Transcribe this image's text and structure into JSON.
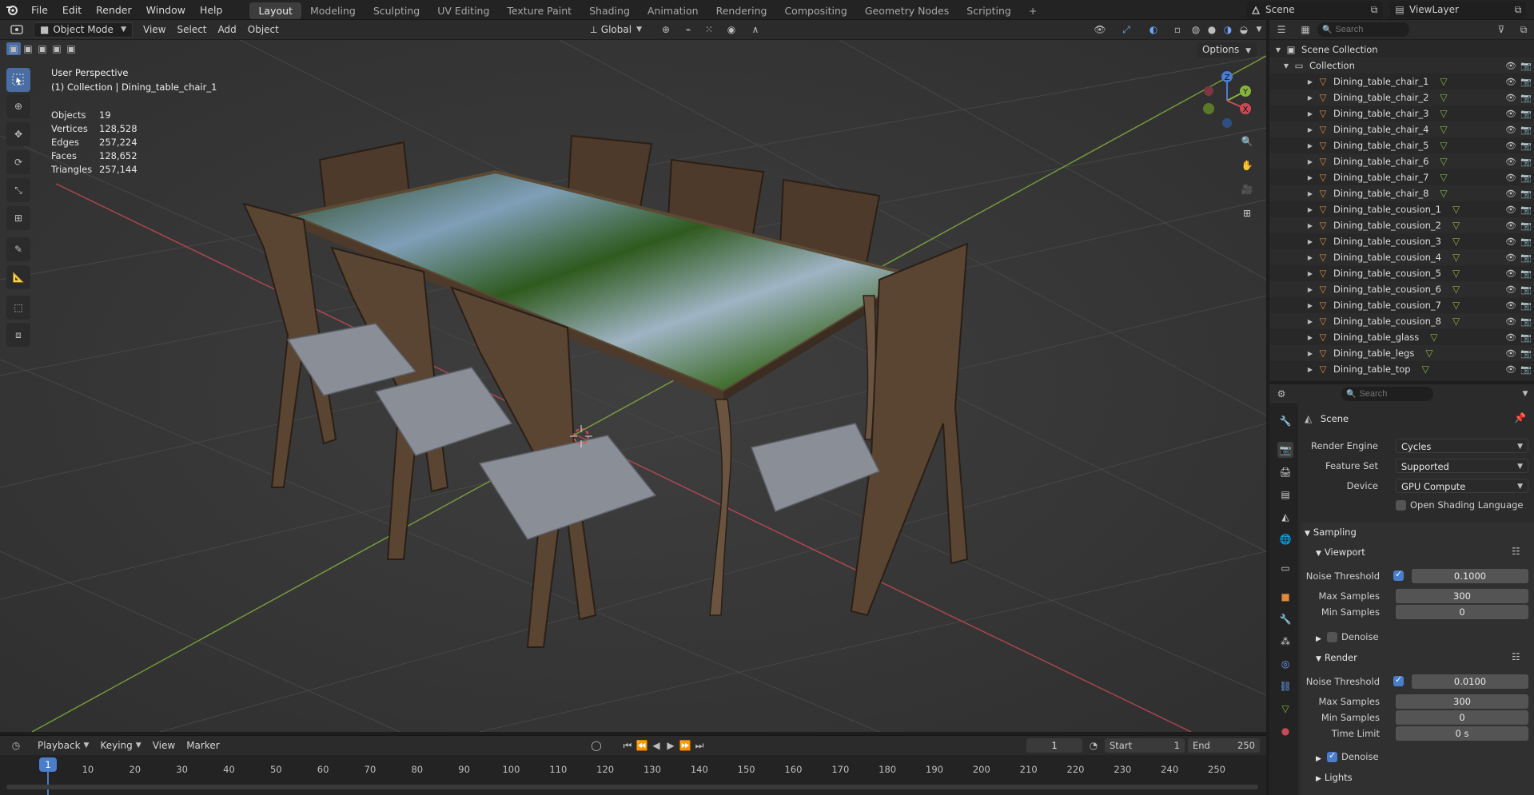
{
  "menu": {
    "items": [
      "File",
      "Edit",
      "Render",
      "Window",
      "Help"
    ]
  },
  "workspaces": {
    "tabs": [
      "Layout",
      "Modeling",
      "Sculpting",
      "UV Editing",
      "Texture Paint",
      "Shading",
      "Animation",
      "Rendering",
      "Compositing",
      "Geometry Nodes",
      "Scripting"
    ],
    "active": "Layout",
    "add_label": "+"
  },
  "scene_selector": {
    "label": "Scene"
  },
  "viewlayer_selector": {
    "label": "ViewLayer"
  },
  "viewport_header": {
    "mode": "Object Mode",
    "menus": [
      "View",
      "Select",
      "Add",
      "Object"
    ],
    "transform_orientation": "Global",
    "options_label": "Options"
  },
  "overlay_info": {
    "perspective": "User Perspective",
    "collection_line": "(1) Collection | Dining_table_chair_1"
  },
  "stats": [
    {
      "label": "Objects",
      "value": "19"
    },
    {
      "label": "Vertices",
      "value": "128,528"
    },
    {
      "label": "Edges",
      "value": "257,224"
    },
    {
      "label": "Faces",
      "value": "128,652"
    },
    {
      "label": "Triangles",
      "value": "257,144"
    }
  ],
  "outliner": {
    "search_placeholder": "Search",
    "root": "Scene Collection",
    "collection": "Collection",
    "objects": [
      "Dining_table_chair_1",
      "Dining_table_chair_2",
      "Dining_table_chair_3",
      "Dining_table_chair_4",
      "Dining_table_chair_5",
      "Dining_table_chair_6",
      "Dining_table_chair_7",
      "Dining_table_chair_8",
      "Dining_table_cousion_1",
      "Dining_table_cousion_2",
      "Dining_table_cousion_3",
      "Dining_table_cousion_4",
      "Dining_table_cousion_5",
      "Dining_table_cousion_6",
      "Dining_table_cousion_7",
      "Dining_table_cousion_8",
      "Dining_table_glass",
      "Dining_table_legs",
      "Dining_table_top"
    ]
  },
  "properties": {
    "search_placeholder": "Search",
    "context": "Scene",
    "render_engine_label": "Render Engine",
    "render_engine": "Cycles",
    "feature_set_label": "Feature Set",
    "feature_set": "Supported",
    "device_label": "Device",
    "device": "GPU Compute",
    "osl_label": "Open Shading Language",
    "osl_checked": false,
    "sampling_label": "Sampling",
    "viewport_label": "Viewport",
    "viewport_noise_label": "Noise Threshold",
    "viewport_noise": "0.1000",
    "viewport_noise_checked": true,
    "viewport_max_label": "Max Samples",
    "viewport_max": "300",
    "viewport_min_label": "Min Samples",
    "viewport_min": "0",
    "viewport_denoise_label": "Denoise",
    "viewport_denoise_checked": false,
    "render_label": "Render",
    "render_noise_label": "Noise Threshold",
    "render_noise": "0.0100",
    "render_noise_checked": true,
    "render_max_label": "Max Samples",
    "render_max": "300",
    "render_min_label": "Min Samples",
    "render_min": "0",
    "time_limit_label": "Time Limit",
    "time_limit": "0 s",
    "render_denoise_label": "Denoise",
    "render_denoise_checked": true,
    "lights_label": "Lights"
  },
  "timeline": {
    "menus": [
      "Playback",
      "Keying",
      "View",
      "Marker"
    ],
    "current_frame": "1",
    "start_label": "Start",
    "start": "1",
    "end_label": "End",
    "end": "250",
    "ticks": [
      "1",
      "10",
      "20",
      "30",
      "40",
      "50",
      "60",
      "70",
      "80",
      "90",
      "100",
      "110",
      "120",
      "130",
      "140",
      "150",
      "160",
      "170",
      "180",
      "190",
      "200",
      "210",
      "220",
      "230",
      "240",
      "250"
    ]
  },
  "gizmo": {
    "x": "X",
    "y": "Y",
    "z": "Z"
  },
  "colors": {
    "accent": "#4a7dcc",
    "active_tool": "#4a6da3",
    "axis_x": "#c94a55",
    "axis_y": "#86b33c",
    "axis_z": "#4a7dd6"
  }
}
